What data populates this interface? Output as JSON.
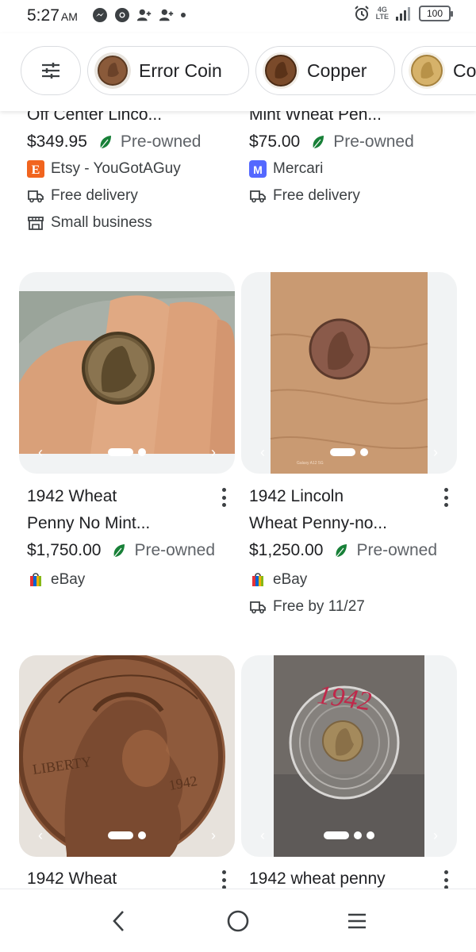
{
  "status_bar": {
    "time": "5:27",
    "ampm": "AM",
    "network": "4G",
    "network_sub": "LTE",
    "battery": "100"
  },
  "chips": [
    {
      "label": "Error Coin"
    },
    {
      "label": "Copper"
    },
    {
      "label": "Co"
    }
  ],
  "products": [
    {
      "title": "Off Center Linco...",
      "price": "$349.95",
      "condition": "Pre-owned",
      "seller": "Etsy - YouGotAGuy",
      "delivery": "Free delivery",
      "badge": "Small business"
    },
    {
      "title": "Mint Wheat Pen...",
      "price": "$75.00",
      "condition": "Pre-owned",
      "seller": "Mercari",
      "delivery": "Free delivery"
    },
    {
      "title_line1": "1942 Wheat",
      "title_line2": "Penny No Mint...",
      "price": "$1,750.00",
      "condition": "Pre-owned",
      "seller": "eBay"
    },
    {
      "title_line1": "1942 Lincoln",
      "title_line2": "Wheat Penny-no...",
      "price": "$1,250.00",
      "condition": "Pre-owned",
      "seller": "eBay",
      "delivery": "Free by 11/27"
    },
    {
      "title_line1": "1942 Wheat"
    },
    {
      "title_line1": "1942 wheat penny"
    }
  ],
  "images": [
    {
      "icon": "coin-on-fingers-photo"
    },
    {
      "icon": "coin-on-skin-photo",
      "watermark": "Galaxy A12 5G"
    },
    {
      "icon": "coin-closeup-photo"
    },
    {
      "icon": "coin-in-capsule-photo",
      "handwriting": "1942"
    }
  ],
  "colors": {
    "accent_leaf": "#188038",
    "etsy": "#F1641E",
    "mercari": "#5468FF"
  }
}
